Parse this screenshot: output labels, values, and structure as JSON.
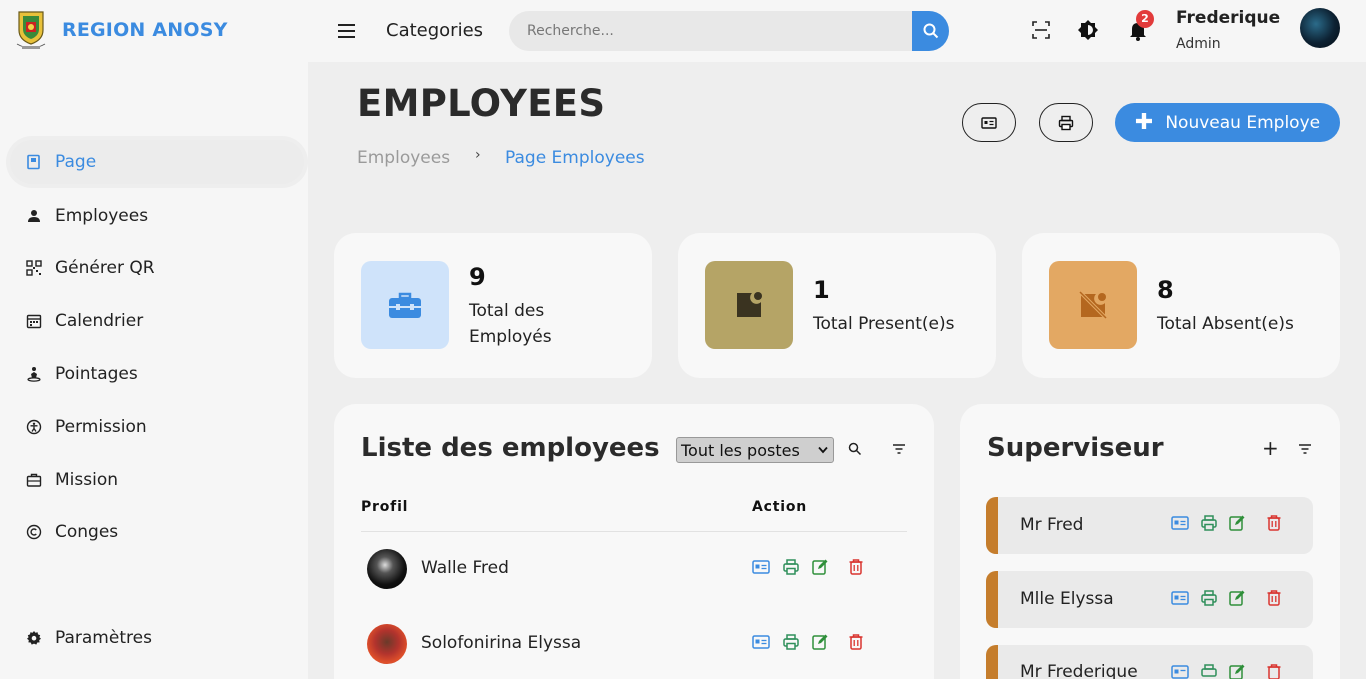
{
  "app": {
    "brand": "REGION ANOSY",
    "categories_label": "Categories",
    "search_placeholder": "Recherche...",
    "notification_count": "2",
    "user": {
      "name": "Frederique",
      "role": "Admin"
    }
  },
  "sidebar": {
    "items": [
      {
        "label": "Page",
        "icon": "book-icon",
        "active": true
      },
      {
        "label": "Employees",
        "icon": "user-icon"
      },
      {
        "label": "Générer QR",
        "icon": "qr-icon"
      },
      {
        "label": "Calendrier",
        "icon": "calendar-icon"
      },
      {
        "label": "Pointages",
        "icon": "pointage-icon"
      },
      {
        "label": "Permission",
        "icon": "accessibility-icon"
      },
      {
        "label": "Mission",
        "icon": "briefcase-icon"
      },
      {
        "label": "Conges",
        "icon": "copyright-icon"
      },
      {
        "label": "Paramètres",
        "icon": "gear-icon"
      }
    ]
  },
  "header": {
    "title": "EMPLOYEES",
    "breadcrumb": [
      "Employees",
      "Page Employees"
    ],
    "breadcrumb_separator": "›",
    "new_button": "Nouveau Employe"
  },
  "stats": [
    {
      "value": "9",
      "label": "Total des Employés",
      "color": "#cfe3fa"
    },
    {
      "value": "1",
      "label": "Total Present(e)s",
      "color": "#b5a466"
    },
    {
      "value": "8",
      "label": "Total Absent(e)s",
      "color": "#e3a863"
    }
  ],
  "employee_list": {
    "title": "Liste des employees",
    "filter_selected": "Tout les postes",
    "columns": [
      "Profil",
      "Action"
    ],
    "rows": [
      {
        "name": "Walle Fred"
      },
      {
        "name": "Solofonirina Elyssa"
      }
    ]
  },
  "supervisor": {
    "title": "Superviseur",
    "add_symbol": "+",
    "items": [
      {
        "name": "Mr Fred"
      },
      {
        "name": "Mlle Elyssa"
      },
      {
        "name": "Mr Frederique"
      }
    ]
  },
  "colors": {
    "accent": "#3b8be0",
    "delete": "#d9342f",
    "print": "#2f8f5b",
    "edit": "#2f8f3a",
    "supervisor_bar": "#c57d2c"
  }
}
